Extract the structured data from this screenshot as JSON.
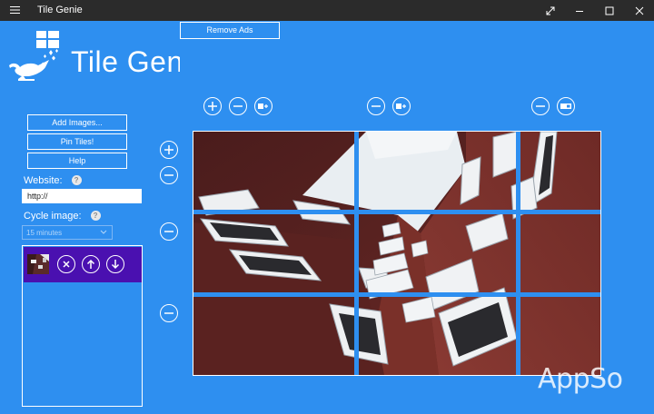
{
  "window": {
    "title": "Tile Genie",
    "menu_icon": "hamburger-icon",
    "controls": [
      "expand-icon",
      "minimize-icon",
      "maximize-icon",
      "close-icon"
    ]
  },
  "header": {
    "remove_ads_label": "Remove Ads",
    "app_title": "Tile Genie",
    "logo_icon": "genie-lamp-logo"
  },
  "sidebar": {
    "buttons": {
      "add_images": "Add Images...",
      "pin_tiles": "Pin Tiles!",
      "help": "Help"
    },
    "website": {
      "label": "Website:",
      "value": "http://",
      "help_glyph": "?"
    },
    "cycle": {
      "label": "Cycle image:",
      "value": "15 minutes",
      "help_glyph": "?"
    },
    "image_list": {
      "items": [
        {
          "thumb_icon": "image-thumbnail",
          "actions": [
            "remove-icon",
            "move-up-icon",
            "move-down-icon"
          ]
        }
      ]
    }
  },
  "grid_controls": {
    "top_left": [
      "add-column-icon",
      "remove-column-icon",
      "add-wide-tile-icon"
    ],
    "top_middle": [
      "remove-column-icon",
      "add-wide-tile-icon"
    ],
    "top_right": [
      "remove-column-icon",
      "wide-tile-icon"
    ],
    "left": [
      "add-row-icon",
      "remove-row-icon",
      "remove-row-icon",
      "remove-row-icon"
    ]
  },
  "canvas": {
    "description_icon": "building-photo",
    "grid_color": "#2e8ff0"
  },
  "colors": {
    "background": "#2e8ff0",
    "titlebar": "#2b2b2b",
    "list_item": "#4a10b0",
    "accent_text": "#ffffff"
  },
  "watermark": "AppSo"
}
